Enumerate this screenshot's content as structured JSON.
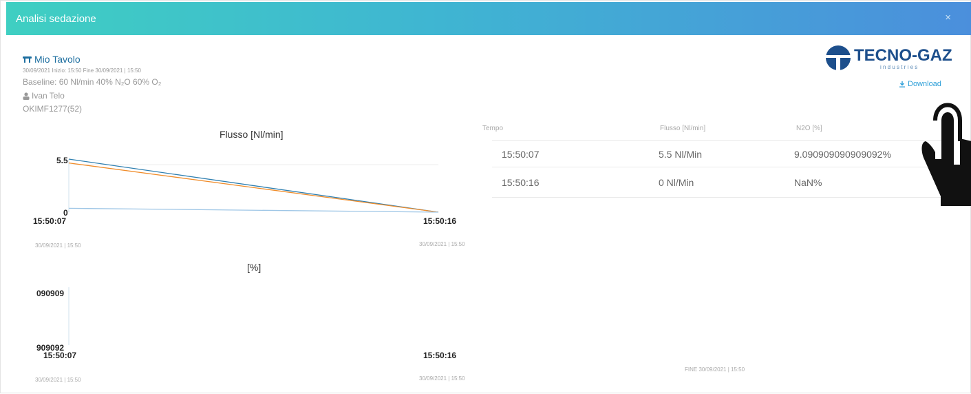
{
  "header": {
    "title": "Analisi sedazione",
    "close_label": "×"
  },
  "info": {
    "table_name": "Mio Tavolo",
    "dates": "30/09/2021 Inizio: 15:50   Fine 30/09/2021 | 15:50",
    "baseline": "Baseline:  60 Nl/min   40% N₂O   60% O₂",
    "operator": "Ivan Telo",
    "device": "OKIMF1277(52)"
  },
  "logo": {
    "name": "TECNO-GAZ",
    "tagline": "i n d u s t r i e s"
  },
  "download_label": "Download",
  "flow_chart": {
    "title": "Flusso [Nl/min]",
    "y_top": "5.5",
    "y_bottom": "0",
    "x_start": "15:50:07",
    "x_end": "15:50:16",
    "date_start": "30/09/2021 | 15:50",
    "date_end": "30/09/2021 | 15:50"
  },
  "pct_chart": {
    "title": "[%]",
    "y_top": "090909",
    "y_bottom": "909092",
    "x_start": "15:50:07",
    "x_end": "15:50:16",
    "date_start": "30/09/2021 | 15:50",
    "date_end": "30/09/2021 | 15:50"
  },
  "chart_data": [
    {
      "type": "line",
      "title": "Flusso [Nl/min]",
      "x": [
        "15:50:07",
        "15:50:16"
      ],
      "ylim": [
        0,
        5.5
      ],
      "series": [
        {
          "values": [
            5.5,
            0
          ],
          "color": "#2f7fb0"
        },
        {
          "values": [
            5.1,
            0
          ],
          "color": "#f08c2a"
        },
        {
          "values": [
            0.4,
            0
          ],
          "color": "#9ec6e6"
        }
      ]
    },
    {
      "type": "line",
      "title": "[%]",
      "x": [
        "15:50:07",
        "15:50:16"
      ],
      "series": []
    }
  ],
  "table": {
    "headers": [
      "Tempo",
      "Flusso [Nl/min]",
      "N2O [%]"
    ],
    "rows": [
      [
        "15:50:07",
        "5.5 Nl/Min",
        "9.090909090909092%"
      ],
      [
        "15:50:16",
        "0 Nl/Min",
        "NaN%"
      ]
    ]
  },
  "footer": {
    "fine": "FINE 30/09/2021 | 15:50"
  }
}
